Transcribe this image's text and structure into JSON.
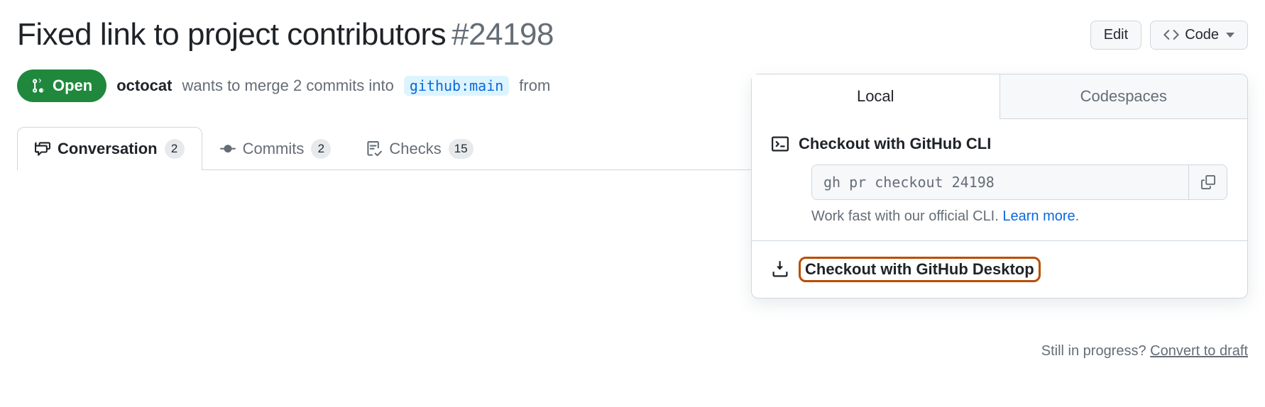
{
  "pr": {
    "title": "Fixed link to project contributors",
    "number": "#24198",
    "state": "Open",
    "author": "octocat",
    "merge_prefix": "wants to merge 2 commits into",
    "base_branch": "github:main",
    "merge_suffix_from": "from"
  },
  "actions": {
    "edit": "Edit",
    "code": "Code"
  },
  "tabs": {
    "conversation": {
      "label": "Conversation",
      "count": "2"
    },
    "commits": {
      "label": "Commits",
      "count": "2"
    },
    "checks": {
      "label": "Checks",
      "count": "15"
    }
  },
  "dropdown": {
    "tab_local": "Local",
    "tab_codespaces": "Codespaces",
    "cli_heading": "Checkout with GitHub CLI",
    "cli_command": "gh pr checkout 24198",
    "cli_hint": "Work fast with our official CLI.",
    "cli_learn": "Learn more",
    "desktop_heading": "Checkout with GitHub Desktop"
  },
  "footer": {
    "draft_prefix": "Still in progress?",
    "draft_link": "Convert to draft"
  }
}
